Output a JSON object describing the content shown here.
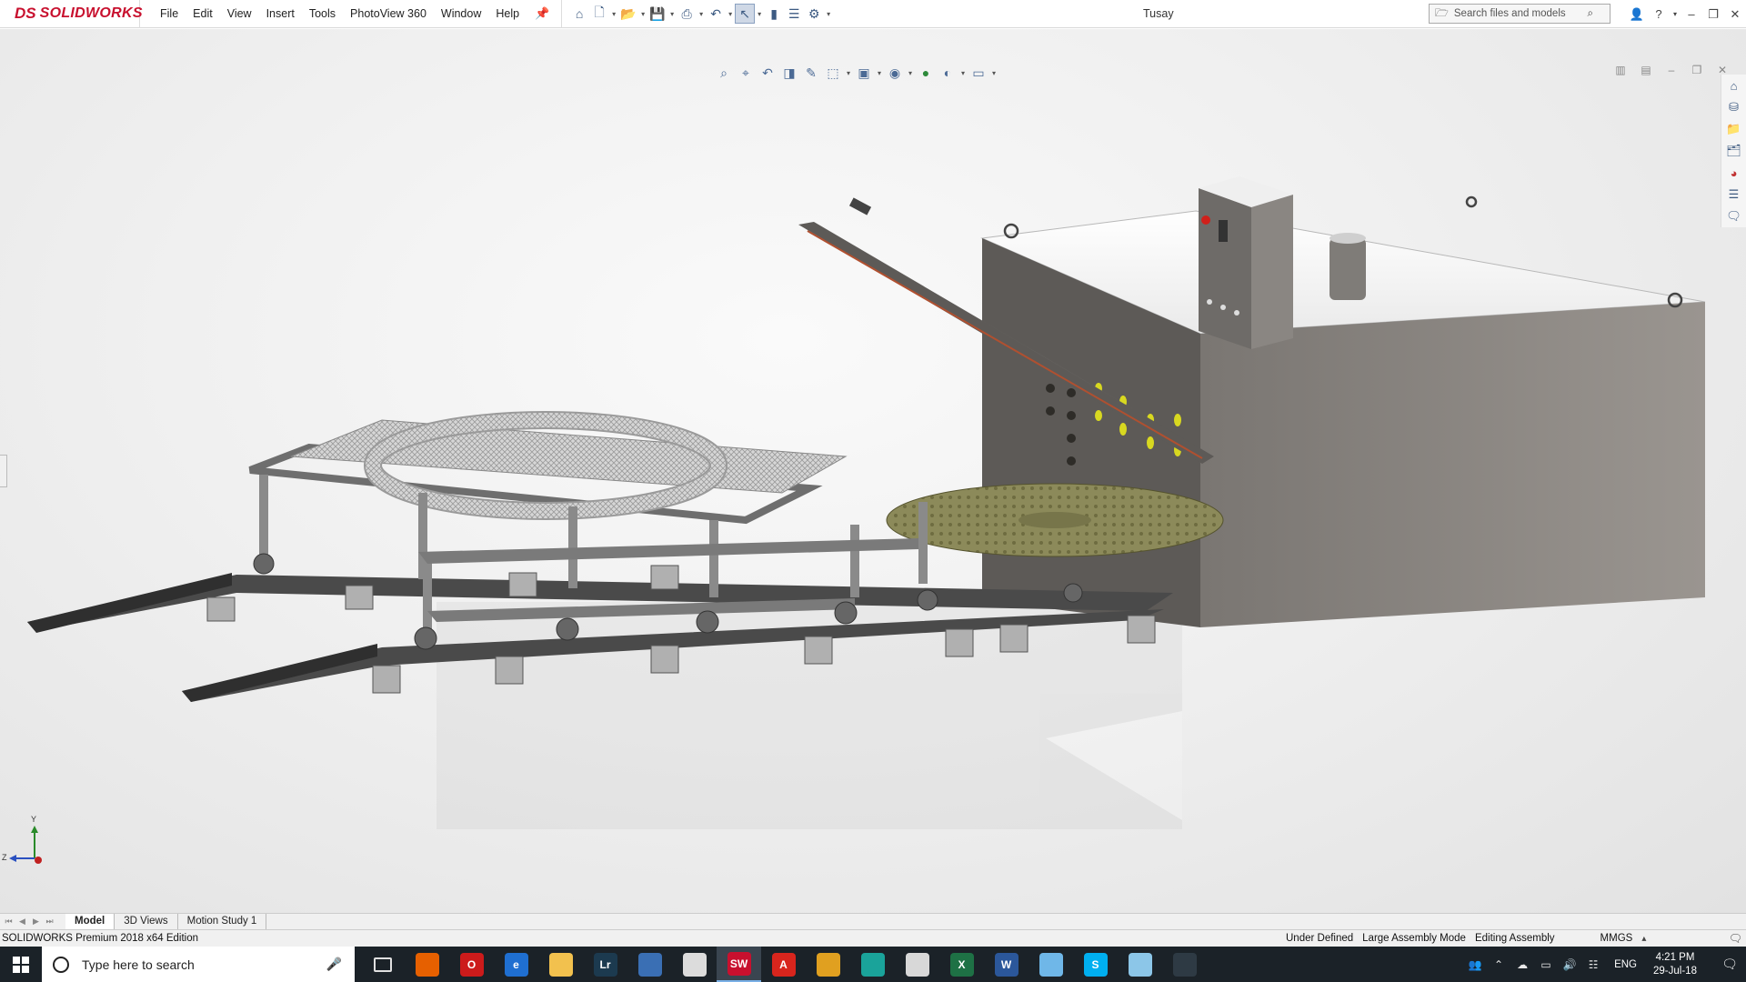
{
  "app": {
    "brand_ds": "DS",
    "brand_name": "SOLIDWORKS",
    "document_title": "Tusay"
  },
  "menu": [
    "File",
    "Edit",
    "View",
    "Insert",
    "Tools",
    "PhotoView 360",
    "Window",
    "Help"
  ],
  "toolbar": {
    "icons": [
      "home-icon",
      "new-icon",
      "open-icon",
      "save-icon",
      "print-icon",
      "undo-icon",
      "select-icon",
      "rebuild-icon",
      "file-props-icon",
      "options-icon"
    ]
  },
  "search": {
    "placeholder": "Search files and models"
  },
  "heads_up_toolbar": {
    "icons": [
      "zoom-fit-icon",
      "zoom-area-icon",
      "previous-view-icon",
      "section-view-icon",
      "dynamic-annotation-icon",
      "view-orientation-icon",
      "display-style-icon",
      "hide-show-icon",
      "edit-appearance-icon",
      "apply-scene-icon",
      "view-settings-icon"
    ]
  },
  "task_pane": {
    "icons": [
      "home-icon",
      "parts-icon",
      "design-library-icon",
      "file-explorer-icon",
      "appearances-icon",
      "custom-properties-icon",
      "forum-icon"
    ]
  },
  "triad": {
    "y": "Y",
    "z": "Z"
  },
  "tabs": [
    {
      "label": "Model",
      "active": true
    },
    {
      "label": "3D Views",
      "active": false
    },
    {
      "label": "Motion Study 1",
      "active": false
    }
  ],
  "status": {
    "edition": "SOLIDWORKS Premium 2018 x64 Edition",
    "under_defined": "Under Defined",
    "large_assembly": "Large Assembly Mode",
    "editing": "Editing Assembly",
    "units": "MMGS"
  },
  "taskbar": {
    "search_placeholder": "Type here to search",
    "apps": [
      {
        "name": "task-view",
        "label": "",
        "color": "#1b2228"
      },
      {
        "name": "firefox",
        "label": "",
        "color": "#e66000"
      },
      {
        "name": "opera",
        "label": "O",
        "color": "#cc1b1b"
      },
      {
        "name": "edge",
        "label": "e",
        "color": "#1f6fd1"
      },
      {
        "name": "file-explorer",
        "label": "",
        "color": "#f2c14e"
      },
      {
        "name": "lightroom",
        "label": "Lr",
        "color": "#1c3a4f"
      },
      {
        "name": "store",
        "label": "",
        "color": "#3a6fb4"
      },
      {
        "name": "mail",
        "label": "",
        "color": "#dcdcdc"
      },
      {
        "name": "solidworks",
        "label": "SW",
        "color": "#c8102e"
      },
      {
        "name": "acrobat",
        "label": "A",
        "color": "#d8251d"
      },
      {
        "name": "keyshot",
        "label": "",
        "color": "#e0a020"
      },
      {
        "name": "globe-app",
        "label": "",
        "color": "#1aa39a"
      },
      {
        "name": "solidworks-launcher",
        "label": "",
        "color": "#d8d8d8"
      },
      {
        "name": "excel",
        "label": "X",
        "color": "#1e7145"
      },
      {
        "name": "word",
        "label": "W",
        "color": "#2b579a"
      },
      {
        "name": "notepad",
        "label": "",
        "color": "#6fb7e8"
      },
      {
        "name": "skype",
        "label": "S",
        "color": "#00aff0"
      },
      {
        "name": "explorer-tool",
        "label": "",
        "color": "#8cc6e8"
      },
      {
        "name": "photos",
        "label": "",
        "color": "#2e3a44"
      }
    ],
    "language": "ENG",
    "time": "4:21 PM",
    "date": "29-Jul-18"
  }
}
